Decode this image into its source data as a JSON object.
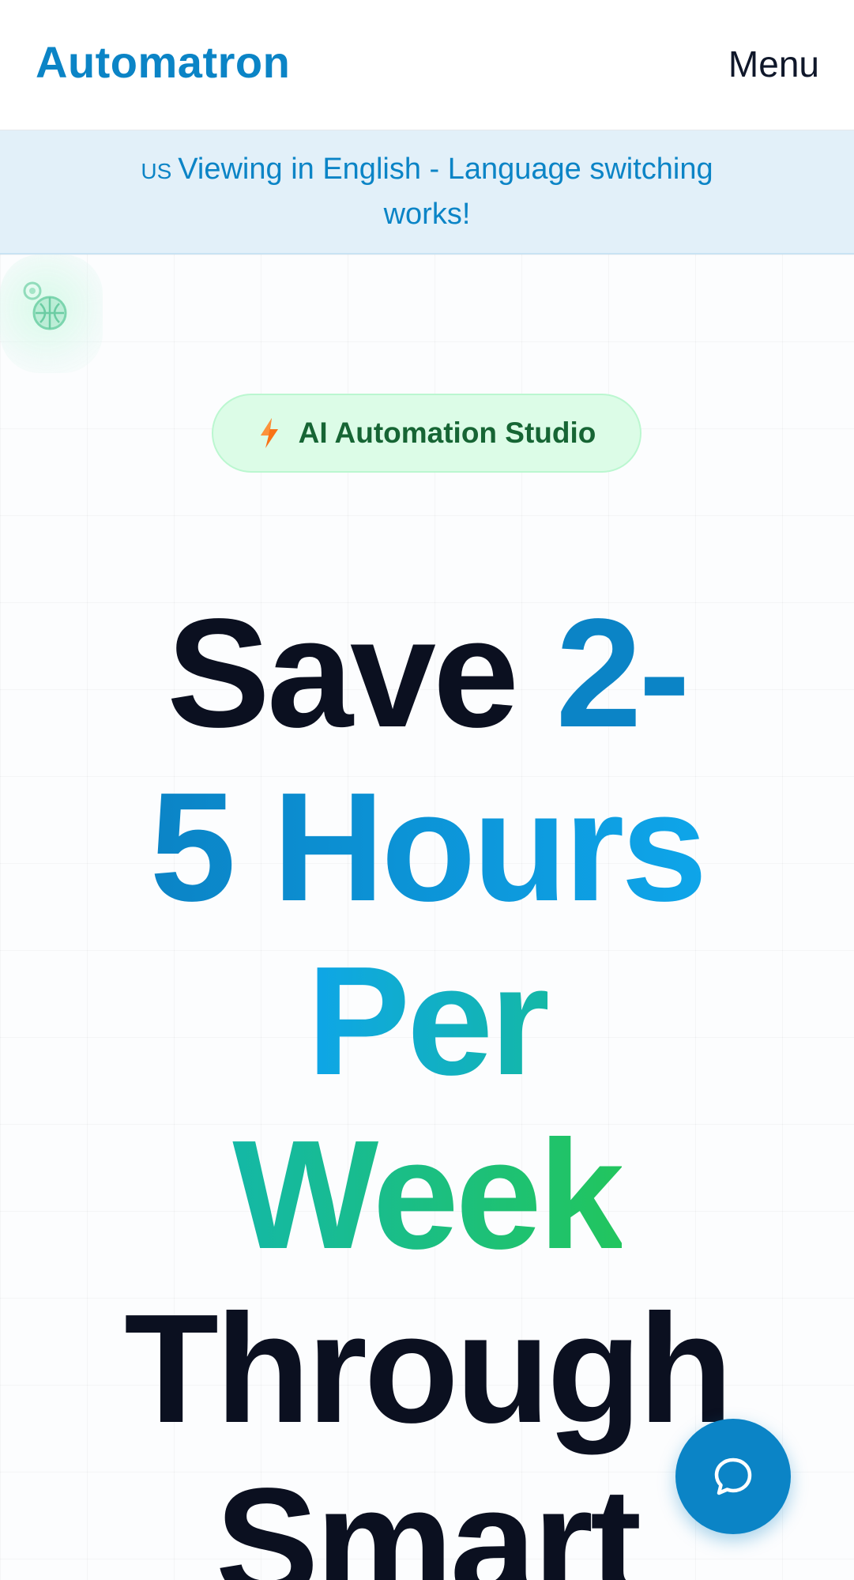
{
  "header": {
    "logo": "Automatron",
    "menu_label": "Menu"
  },
  "banner": {
    "flag": "US",
    "text": "Viewing in English - Language switching works!"
  },
  "hero": {
    "badge": {
      "icon": "lightning-bolt-icon",
      "label": "AI Automation Studio"
    },
    "headline": {
      "line1_dark": "Save ",
      "line1_accent": "2-",
      "line2": "5 Hours",
      "line3": "Per",
      "line4": "Week",
      "line5": "Through",
      "line6": "Smart"
    }
  },
  "chat": {
    "icon": "chat-bubble-icon"
  },
  "colors": {
    "brand": "#0b84c6",
    "badge_bg": "#dcfce7",
    "badge_text": "#166534",
    "banner_bg": "#e2f0f9",
    "headline_dark": "#0b1020",
    "accent_green": "#22c55e"
  }
}
